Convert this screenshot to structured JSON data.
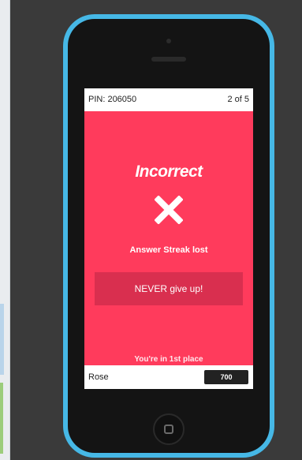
{
  "quiz": {
    "pin_label": "PIN: 206050",
    "progress": "2 of 5",
    "result_title": "Incorrect",
    "result_icon": "x-icon",
    "streak_message": "Answer Streak lost",
    "motivation_message": "NEVER give up!",
    "rank_status": "You're in 1st place",
    "player_name": "Rose",
    "score": "700"
  },
  "colors": {
    "screen_background": "#ff3b5c",
    "motivation_box": "#d92f4f",
    "phone_body": "#46b8e6"
  }
}
